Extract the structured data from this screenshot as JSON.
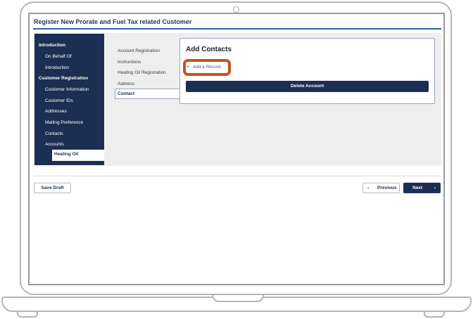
{
  "window": {
    "title": "Register New Prorate and Fuel Tax related Customer"
  },
  "sidebar": {
    "items": [
      {
        "label": "Introduction",
        "type": "section"
      },
      {
        "label": "On Behalf Of",
        "type": "item"
      },
      {
        "label": "Introduction",
        "type": "item"
      },
      {
        "label": "Customer Registration",
        "type": "section"
      },
      {
        "label": "Customer Information",
        "type": "item"
      },
      {
        "label": "Customer IDs",
        "type": "item"
      },
      {
        "label": "Addresses",
        "type": "item"
      },
      {
        "label": "Mailing Preference",
        "type": "item"
      },
      {
        "label": "Contacts",
        "type": "item"
      },
      {
        "label": "Accounts",
        "type": "item"
      }
    ],
    "active_item": "Heating Oil"
  },
  "substeps": {
    "items": [
      "Account Registration",
      "Instructions",
      "Heating Oil Registration",
      "Address"
    ],
    "active": "Contact"
  },
  "card": {
    "title": "Add Contacts",
    "add_icon": "+",
    "add_label": "Add a Record",
    "delete_label": "Delete Account"
  },
  "footer": {
    "save_label": "Save Draft",
    "prev_label": "Previous",
    "prev_icon": "‹",
    "next_label": "Next",
    "next_icon": "›"
  },
  "colors": {
    "navy": "#1c2f52",
    "highlight": "#c6501f",
    "link": "#2b5fa3"
  }
}
